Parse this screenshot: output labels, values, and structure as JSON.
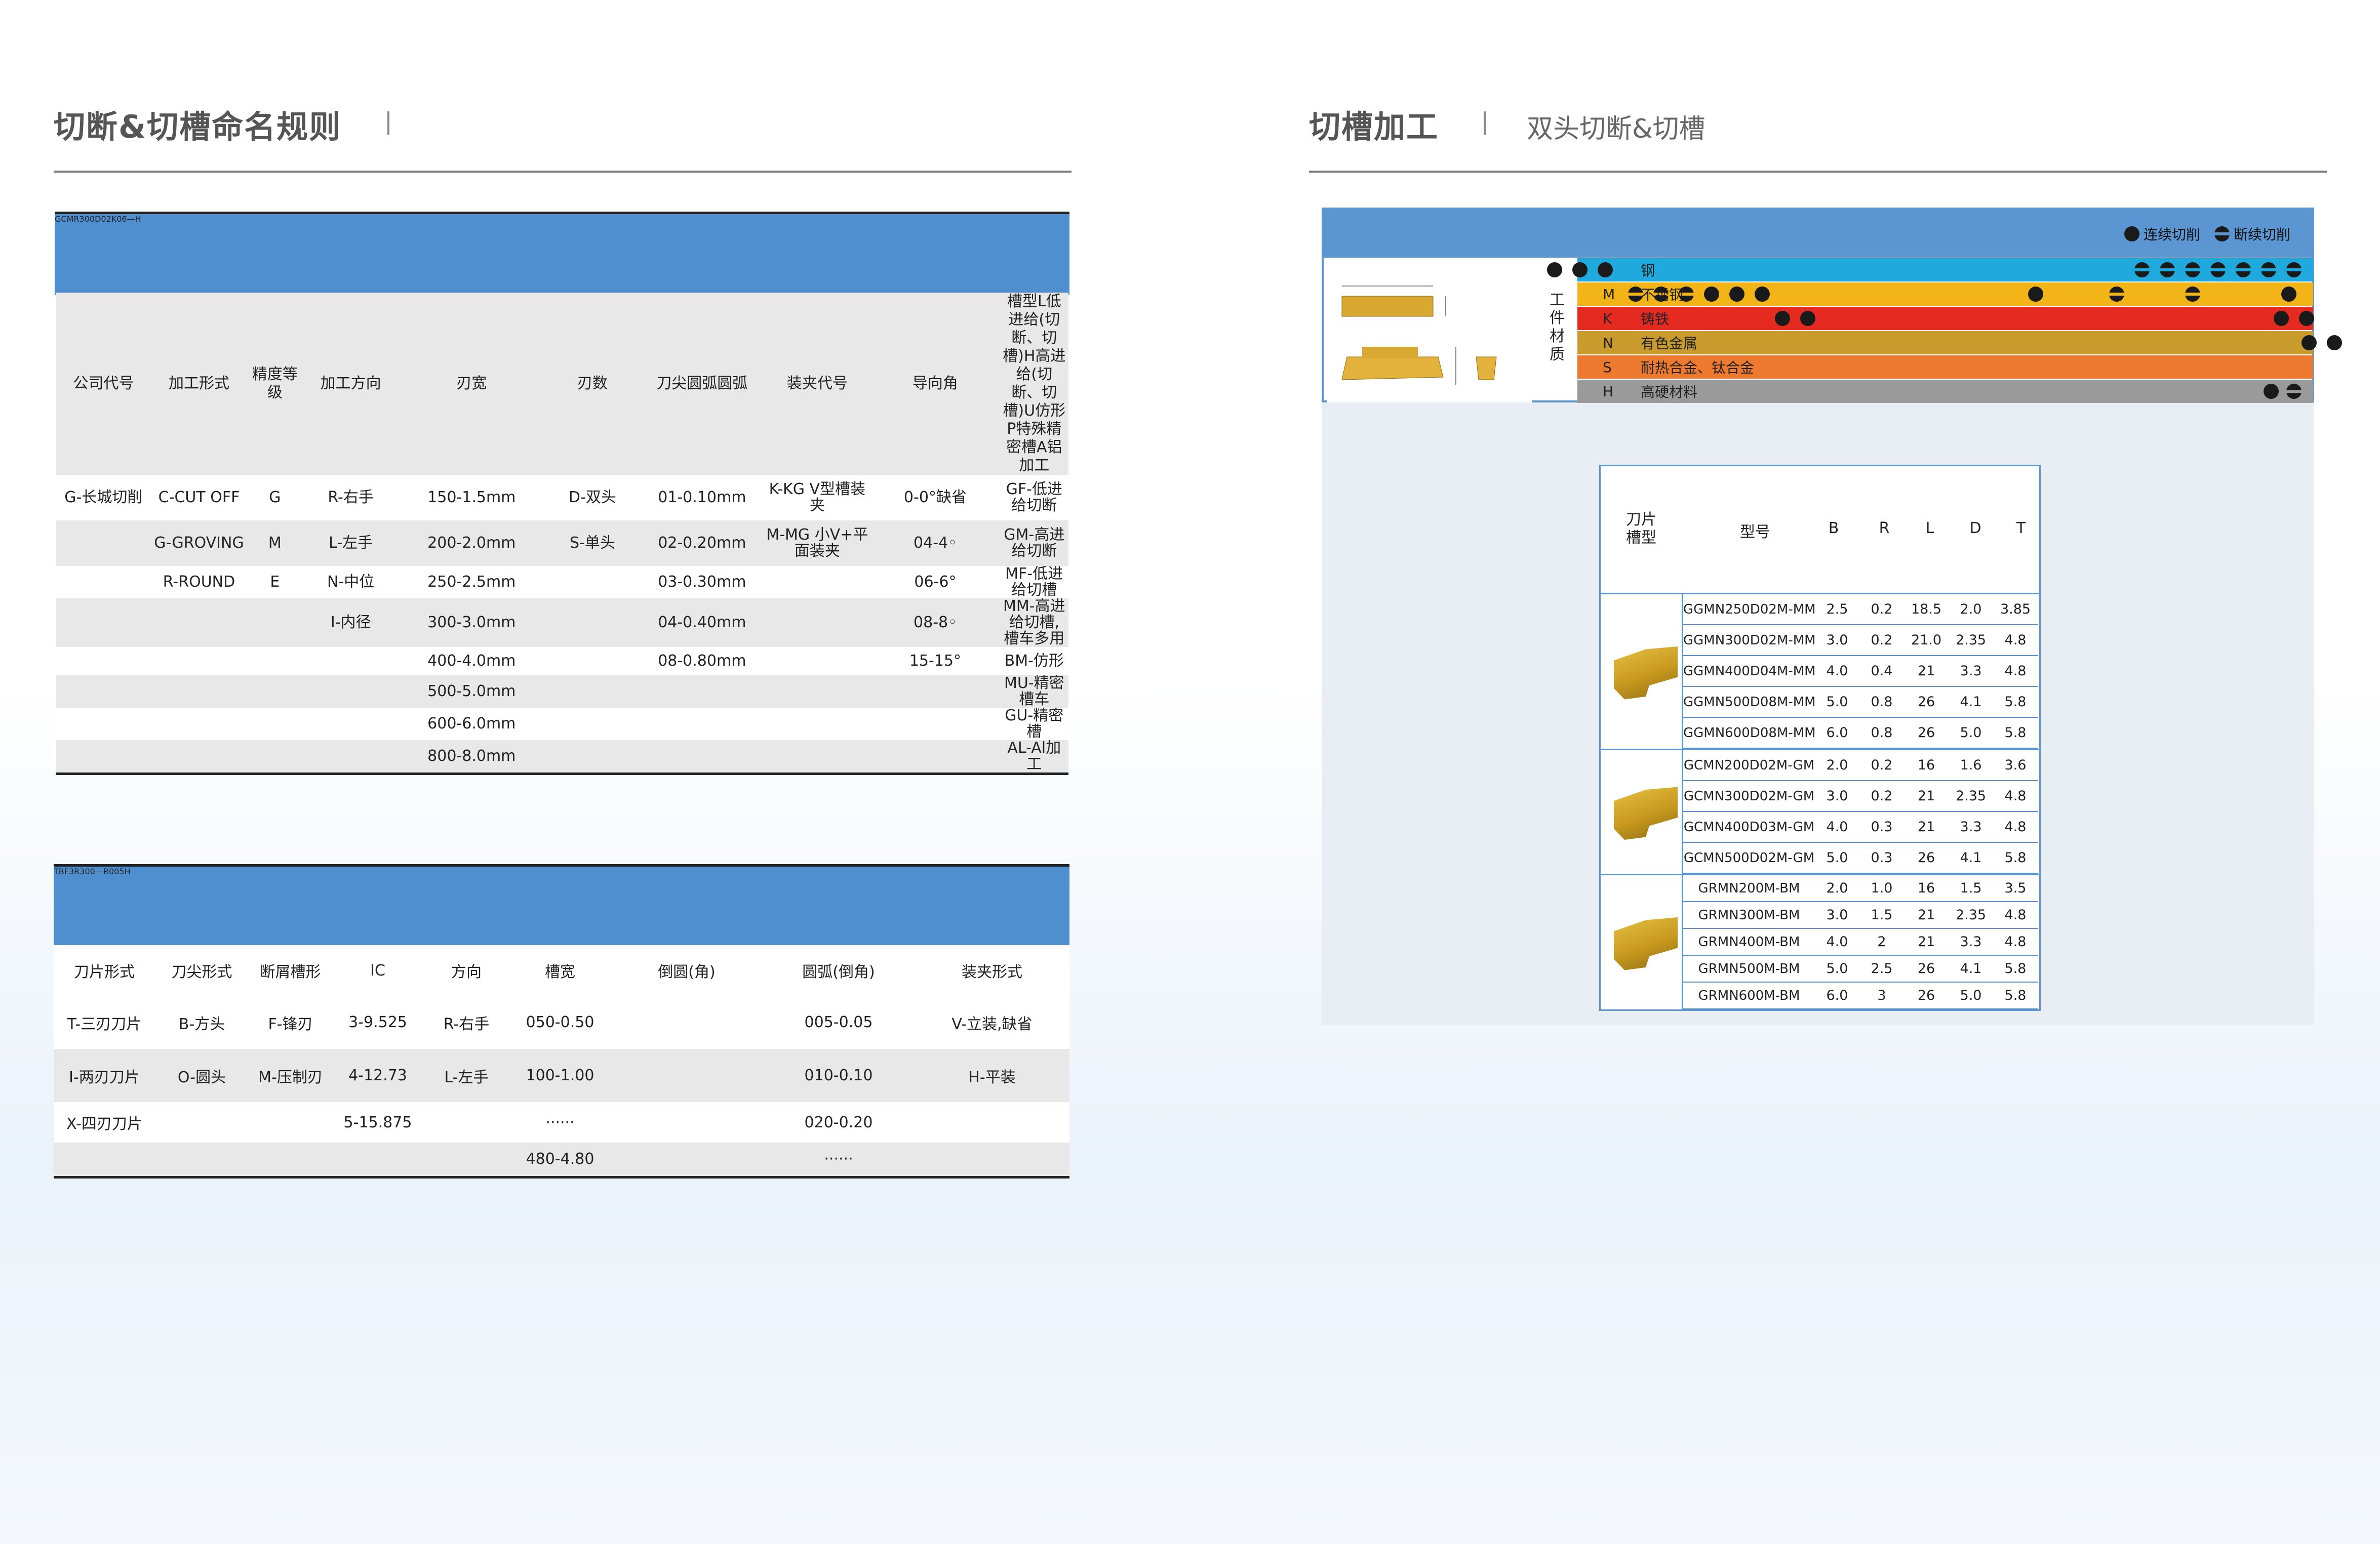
{
  "left": {
    "title": "切断&切槽命名规则",
    "code1": {
      "letters": [
        "G",
        "C",
        "M",
        "R",
        "300",
        "D",
        "02",
        "K",
        "06—",
        "H"
      ],
      "headers": [
        "公司代号",
        "加工形式",
        "精度等级",
        "加工方向",
        "刃宽",
        "刃数",
        "刀尖圆弧圆弧",
        "装夹代号",
        "导向角",
        "槽型L低进给(切断、切槽)H高进给(切断、切槽)U仿形P特殊精密槽A铝加工"
      ],
      "rows": [
        [
          "G-长城切削",
          "C-CUT OFF",
          "G",
          "R-右手",
          "150-1.5mm",
          "D-双头",
          "01-0.10mm",
          "K-KG V型槽装夹",
          "0-0°缺省",
          "GF-低进给切断"
        ],
        [
          "",
          "G-GROVING",
          "M",
          "L-左手",
          "200-2.0mm",
          "S-单头",
          "02-0.20mm",
          "M-MG 小V+平面装夹",
          "04-4◦",
          "GM-高进给切断"
        ],
        [
          "",
          "R-ROUND",
          "E",
          "N-中位",
          "250-2.5mm",
          "",
          "03-0.30mm",
          "",
          "06-6°",
          "MF-低进给切槽"
        ],
        [
          "",
          "",
          "",
          "I-内径",
          "300-3.0mm",
          "",
          "04-0.40mm",
          "",
          "08-8◦",
          "MM-高进给切槽,槽车多用"
        ],
        [
          "",
          "",
          "",
          "",
          "400-4.0mm",
          "",
          "08-0.80mm",
          "",
          "15-15°",
          "BM-仿形"
        ],
        [
          "",
          "",
          "",
          "",
          "500-5.0mm",
          "",
          "",
          "",
          "",
          "MU-精密槽车"
        ],
        [
          "",
          "",
          "",
          "",
          "600-6.0mm",
          "",
          "",
          "",
          "",
          "GU-精密槽"
        ],
        [
          "",
          "",
          "",
          "",
          "800-8.0mm",
          "",
          "",
          "",
          "",
          "AL-Al加工"
        ]
      ]
    },
    "code2": {
      "letters": [
        "T",
        "B",
        "F",
        "3",
        "R",
        "300",
        "—",
        "R",
        "005",
        "H"
      ],
      "headers": [
        "刀片形式",
        "刀尖形式",
        "断屑槽形",
        "IC",
        "方向",
        "槽宽",
        "倒圆(角)",
        "圆弧(倒角)",
        "装夹形式"
      ],
      "rows": [
        [
          "T-三刃刀片",
          "B-方头",
          "F-锋刃",
          "3-9.525",
          "R-右手",
          "050-0.50",
          "",
          "005-0.05",
          "V-立装,缺省"
        ],
        [
          "I-两刃刀片",
          "O-圆头",
          "M-压制刃",
          "4-12.73",
          "L-左手",
          "100-1.00",
          "",
          "010-0.10",
          "H-平装"
        ],
        [
          "X-四刃刀片",
          "",
          "",
          "5-15.875",
          "",
          "······",
          "",
          "020-0.20",
          ""
        ],
        [
          "",
          "",
          "",
          "",
          "",
          "480-4.80",
          "",
          "······",
          ""
        ]
      ]
    }
  },
  "right": {
    "title": "切槽加工",
    "subtitle": "双头切断&切槽",
    "legend": {
      "continuous": "连续切削",
      "interrupted": "断续切削"
    },
    "material_label": "工件材质",
    "materials": [
      {
        "code": "P",
        "name": "钢",
        "color": "#1fa9dc",
        "solid_dots": [
          0,
          1,
          2
        ],
        "half_dots": []
      },
      {
        "code": "M",
        "name": "不锈钢",
        "color": "#f2b416",
        "solid_dots": [],
        "half_dots": []
      },
      {
        "code": "K",
        "name": "铸铁",
        "color": "#e52a22",
        "solid_dots": [],
        "half_dots": []
      },
      {
        "code": "N",
        "name": "有色金属",
        "color": "#c99a2c",
        "solid_dots": [],
        "half_dots": []
      },
      {
        "code": "S",
        "name": "耐热合金、钛合金",
        "color": "#ee7a2f",
        "solid_dots": [],
        "half_dots": []
      },
      {
        "code": "H",
        "name": "高硬材料",
        "color": "#9a9a9a",
        "solid_dots": [],
        "half_dots": []
      }
    ],
    "table": {
      "headers": [
        "刀片槽型",
        "型号",
        "B",
        "R",
        "L",
        "D",
        "T"
      ],
      "groups": [
        {
          "rows": [
            [
              "GGMN250D02M-MM",
              "2.5",
              "0.2",
              "18.5",
              "2.0",
              "3.85"
            ],
            [
              "GGMN300D02M-MM",
              "3.0",
              "0.2",
              "21.0",
              "2.35",
              "4.8"
            ],
            [
              "GGMN400D04M-MM",
              "4.0",
              "0.4",
              "21",
              "3.3",
              "4.8"
            ],
            [
              "GGMN500D08M-MM",
              "5.0",
              "0.8",
              "26",
              "4.1",
              "5.8"
            ],
            [
              "GGMN600D08M-MM",
              "6.0",
              "0.8",
              "26",
              "5.0",
              "5.8"
            ]
          ]
        },
        {
          "rows": [
            [
              "GCMN200D02M-GM",
              "2.0",
              "0.2",
              "16",
              "1.6",
              "3.6"
            ],
            [
              "GCMN300D02M-GM",
              "3.0",
              "0.2",
              "21",
              "2.35",
              "4.8"
            ],
            [
              "GCMN400D03M-GM",
              "4.0",
              "0.3",
              "21",
              "3.3",
              "4.8"
            ],
            [
              "GCMN500D02M-GM",
              "5.0",
              "0.3",
              "26",
              "4.1",
              "5.8"
            ]
          ]
        },
        {
          "rows": [
            [
              "GRMN200M-BM",
              "2.0",
              "1.0",
              "16",
              "1.5",
              "3.5"
            ],
            [
              "GRMN300M-BM",
              "3.0",
              "1.5",
              "21",
              "2.35",
              "4.8"
            ],
            [
              "GRMN400M-BM",
              "4.0",
              "2",
              "21",
              "3.3",
              "4.8"
            ],
            [
              "GRMN500M-BM",
              "5.0",
              "2.5",
              "26",
              "4.1",
              "5.8"
            ],
            [
              "GRMN600M-BM",
              "6.0",
              "3",
              "26",
              "5.0",
              "5.8"
            ]
          ]
        }
      ]
    }
  }
}
